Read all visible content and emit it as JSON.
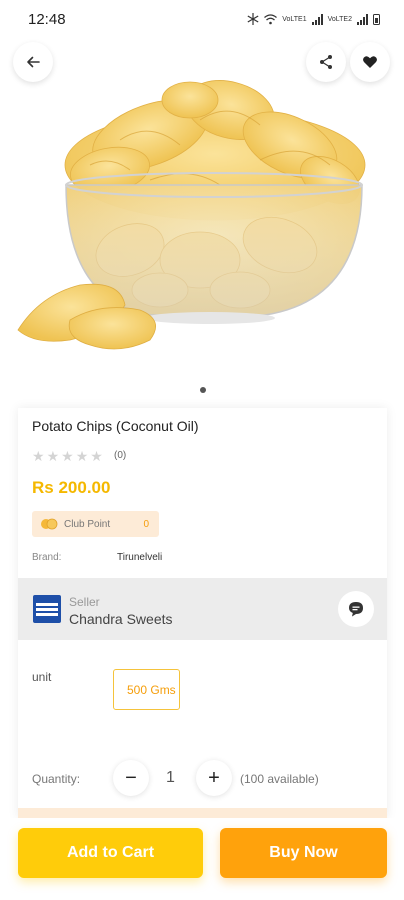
{
  "status_bar": {
    "time": "12:48",
    "network_1": "VoLTE1",
    "network_2": "VoLTE2"
  },
  "icons": {
    "back": "arrow-left-icon",
    "share": "share-icon",
    "favorite": "heart-icon",
    "chat": "chat-bubble-icon",
    "club": "coins-icon"
  },
  "product": {
    "title": "Potato Chips (Coconut Oil)",
    "rating_stars": 0,
    "rating_count": "(0)",
    "price": "Rs 200.00",
    "club_point_label": "Club Point",
    "club_point_value": "0",
    "brand_label": "Brand:",
    "brand_value": "Tirunelveli"
  },
  "seller": {
    "kicker": "Seller",
    "name": "Chandra Sweets"
  },
  "unit": {
    "label": "unit",
    "selected": "500 Gms"
  },
  "quantity": {
    "label": "Quantity:",
    "minus": "−",
    "value": "1",
    "plus": "+",
    "available": "(100 available)"
  },
  "actions": {
    "add_to_cart": "Add to Cart",
    "buy_now": "Buy Now"
  },
  "colors": {
    "accent_yellow": "#ffcc0a",
    "accent_orange": "#ffa20c",
    "price": "#f5b800"
  }
}
